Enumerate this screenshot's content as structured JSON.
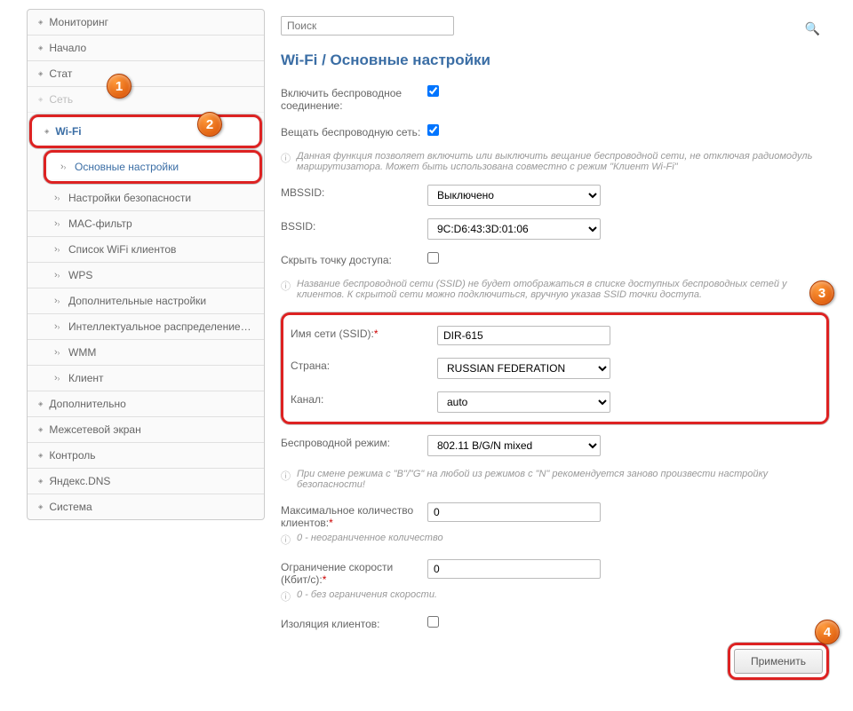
{
  "search": {
    "placeholder": "Поиск"
  },
  "page_title": "Wi-Fi /  Основные настройки",
  "sidebar": {
    "items": [
      {
        "label": "Мониторинг"
      },
      {
        "label": "Начало"
      },
      {
        "label": "Стат"
      },
      {
        "label": "Сеть"
      },
      {
        "label": "Wi-Fi"
      },
      {
        "label": "Дополнительно"
      },
      {
        "label": "Межсетевой экран"
      },
      {
        "label": "Контроль"
      },
      {
        "label": "Яндекс.DNS"
      },
      {
        "label": "Система"
      }
    ],
    "wifi_sub": [
      {
        "label": "Основные настройки"
      },
      {
        "label": "Настройки безопасности"
      },
      {
        "label": "MAC-фильтр"
      },
      {
        "label": "Список WiFi клиентов"
      },
      {
        "label": "WPS"
      },
      {
        "label": "Дополнительные настройки"
      },
      {
        "label": "Интеллектуальное распределение Wi-Fi-"
      },
      {
        "label": "WMM"
      },
      {
        "label": "Клиент"
      }
    ]
  },
  "form": {
    "enable_wireless": "Включить беспроводное соединение:",
    "broadcast": "Вещать беспроводную сеть:",
    "broadcast_info": "Данная функция позволяет включить или выключить вещание беспроводной сети, не отключая радиомодуль маршрутизатора. Может быть использована совместно с режим \"Клиент Wi-Fi\"",
    "mbssid": "MBSSID:",
    "mbssid_value": "Выключено",
    "bssid": "BSSID:",
    "bssid_value": "9C:D6:43:3D:01:06",
    "hide_ap": "Скрыть точку доступа:",
    "hide_ap_info": "Название беспроводной сети (SSID) не будет отображаться в списке доступных беспроводных сетей у клиентов. К скрытой сети можно подключиться, вручную указав SSID точки доступа.",
    "ssid": "Имя сети (SSID):",
    "ssid_value": "DIR-615",
    "country": "Страна:",
    "country_value": "RUSSIAN FEDERATION",
    "channel": "Канал:",
    "channel_value": "auto",
    "mode": "Беспроводной режим:",
    "mode_value": "802.11 B/G/N mixed",
    "mode_info": "При смене режима с \"B\"/\"G\" на любой из режимов с \"N\" рекомендуется заново произвести настройку безопасности!",
    "max_clients": "Максимальное количество клиентов:",
    "max_clients_value": "0",
    "max_clients_info": "0 - неограниченное количество",
    "rate_limit": "Ограничение скорости (Кбит/c):",
    "rate_limit_value": "0",
    "rate_limit_info": "0 - без ограничения скорости.",
    "client_isolation": "Изоляция клиентов:"
  },
  "buttons": {
    "apply": "Применить"
  },
  "markers": {
    "m1": "1",
    "m2": "2",
    "m3": "3",
    "m4": "4"
  }
}
